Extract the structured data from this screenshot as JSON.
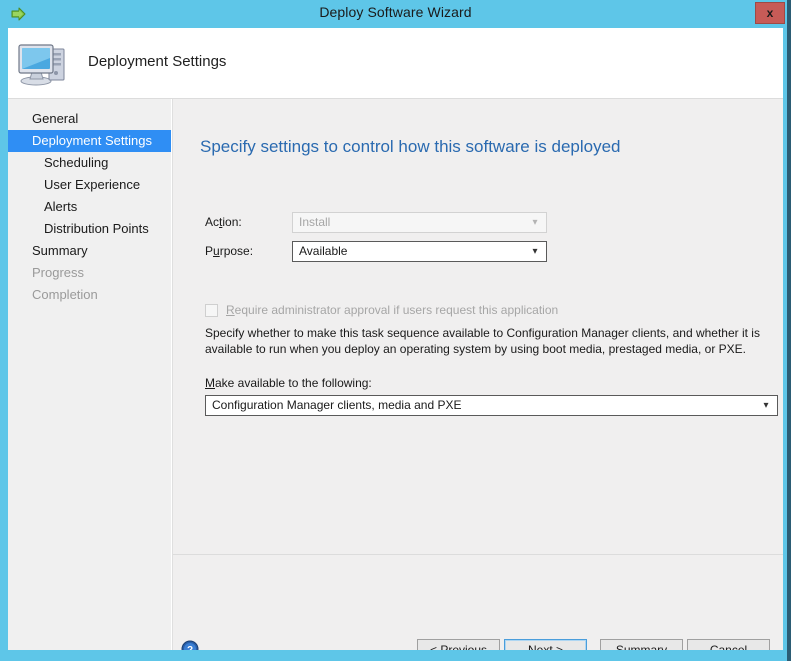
{
  "window": {
    "title": "Deploy Software Wizard",
    "titlebar_icon": "green-arrow-icon",
    "close_label": "x",
    "accent_blue": "#5ec6e8",
    "close_button_color": "#c75b57"
  },
  "header": {
    "title": "Deployment Settings",
    "icon": "computer-icon"
  },
  "sidebar": {
    "items": [
      {
        "label": "General",
        "state": "normal",
        "indent": false
      },
      {
        "label": "Deployment Settings",
        "state": "selected",
        "indent": false
      },
      {
        "label": "Scheduling",
        "state": "normal",
        "indent": true
      },
      {
        "label": "User Experience",
        "state": "normal",
        "indent": true
      },
      {
        "label": "Alerts",
        "state": "normal",
        "indent": true
      },
      {
        "label": "Distribution Points",
        "state": "normal",
        "indent": true
      },
      {
        "label": "Summary",
        "state": "normal",
        "indent": false
      },
      {
        "label": "Progress",
        "state": "disabled",
        "indent": false
      },
      {
        "label": "Completion",
        "state": "disabled",
        "indent": false
      }
    ],
    "selected_color": "#2f8ef4"
  },
  "content": {
    "heading": "Specify settings to control how this software is deployed",
    "heading_color": "#2a6ab0",
    "action": {
      "label": "Action:",
      "accel_prefix": "Ac",
      "accel_char": "t",
      "accel_suffix": "ion:",
      "value": "Install",
      "enabled": false
    },
    "purpose": {
      "label": "Purpose:",
      "accel_prefix": "P",
      "accel_char": "u",
      "accel_suffix": "rpose:",
      "value": "Available",
      "enabled": true
    },
    "approval_checkbox": {
      "accel_char": "R",
      "accel_suffix": "equire administrator approval if users request this application",
      "checked": false,
      "enabled": false
    },
    "description": "Specify whether to make this task sequence available to Configuration Manager clients, and whether it is available to run when you deploy an operating system by using boot media, prestaged media, or PXE.",
    "make_available": {
      "accel_char": "M",
      "accel_suffix": "ake available to the following:",
      "value": "Configuration Manager clients, media and PXE",
      "enabled": true
    },
    "dropdown_arrow": "chevron-down-icon"
  },
  "footer": {
    "help_icon": "help-icon",
    "buttons": [
      {
        "id": "previous",
        "prefix": "< ",
        "accel_char": "P",
        "suffix": "revious",
        "focused": false
      },
      {
        "id": "next",
        "prefix": "",
        "accel_char": "N",
        "suffix": "ext >",
        "focused": true
      },
      {
        "id": "summary",
        "prefix": "",
        "accel_char": "S",
        "suffix": "ummary",
        "focused": false
      },
      {
        "id": "cancel",
        "prefix": "",
        "accel_char": "",
        "suffix": "Cancel",
        "focused": false
      }
    ]
  }
}
